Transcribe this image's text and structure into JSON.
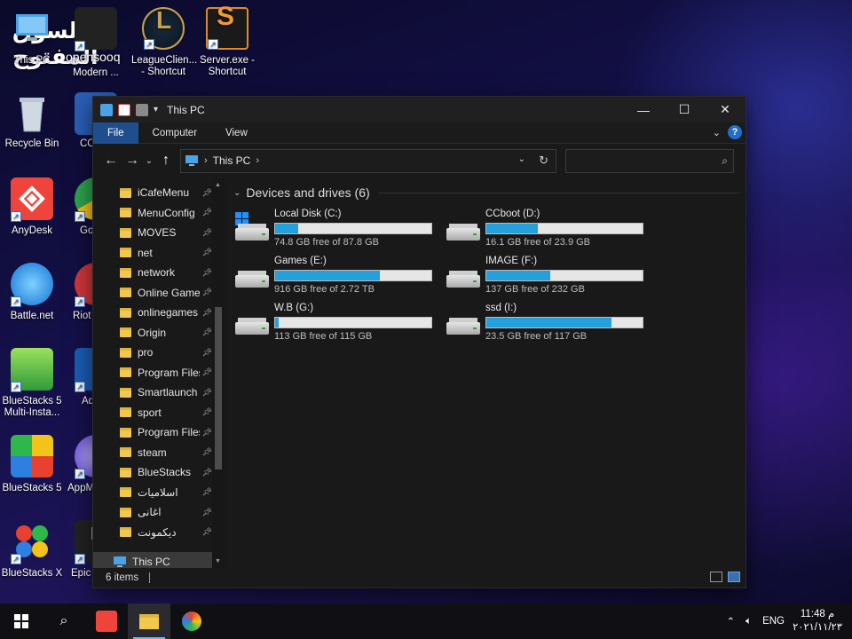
{
  "watermark": {
    "arabic": "السوق المفتوح",
    "latin": "opensooq"
  },
  "desktop": {
    "icons": [
      {
        "label": "This PC"
      },
      {
        "label": "Modern ..."
      },
      {
        "label": "LeagueClien... - Shortcut"
      },
      {
        "label": "Server.exe - Shortcut"
      },
      {
        "label": "Recycle Bin"
      },
      {
        "label": "CC"
      },
      {
        "label": "AnyDesk"
      },
      {
        "label": "Go Ch"
      },
      {
        "label": "Battle.net"
      },
      {
        "label": "Riot"
      },
      {
        "label": "BlueStacks 5 Multi-Insta..."
      },
      {
        "label": "Ad"
      },
      {
        "label": "BlueStacks 5"
      },
      {
        "label": "AppM - Sh"
      },
      {
        "label": "BlueStacks X"
      },
      {
        "label": "Epic Lau"
      }
    ]
  },
  "window": {
    "title": "This PC",
    "ribbon_tabs": [
      "File",
      "Computer",
      "View"
    ],
    "help": "?",
    "address": {
      "crumb": "This PC"
    },
    "search": {
      "placeholder": ""
    },
    "nav_items": [
      {
        "label": "iCafeMenu"
      },
      {
        "label": "MenuConfig"
      },
      {
        "label": "MOVES"
      },
      {
        "label": "net"
      },
      {
        "label": "network"
      },
      {
        "label": "Online Game"
      },
      {
        "label": "onlinegames"
      },
      {
        "label": "Origin"
      },
      {
        "label": "pro"
      },
      {
        "label": "Program Files"
      },
      {
        "label": "Smartlaunch"
      },
      {
        "label": "sport"
      },
      {
        "label": "Program Files"
      },
      {
        "label": "steam"
      },
      {
        "label": "BlueStacks"
      },
      {
        "label": "اسلاميات"
      },
      {
        "label": "اغانى"
      },
      {
        "label": "ديكمونت"
      }
    ],
    "nav_selected": "This PC",
    "group_title": "Devices and drives (6)",
    "drives": [
      {
        "name": "Local Disk (C:)",
        "free": "74.8 GB free of 87.8 GB",
        "used_fraction": 0.15,
        "windows": true
      },
      {
        "name": "CCboot (D:)",
        "free": "16.1 GB free of 23.9 GB",
        "used_fraction": 0.33,
        "windows": false
      },
      {
        "name": "Games (E:)",
        "free": "916 GB free of 2.72 TB",
        "used_fraction": 0.67,
        "windows": false
      },
      {
        "name": "IMAGE (F:)",
        "free": "137 GB free of 232 GB",
        "used_fraction": 0.41,
        "windows": false
      },
      {
        "name": "W.B (G:)",
        "free": "113 GB free of 115 GB",
        "used_fraction": 0.02,
        "windows": false
      },
      {
        "name": "ssd (I:)",
        "free": "23.5 GB free of 117 GB",
        "used_fraction": 0.8,
        "windows": false
      }
    ],
    "status": {
      "count": "6 items"
    }
  },
  "taskbar": {
    "language": "ENG",
    "time": "11:48 م",
    "date": "٢٠٢١/١١/٢٣"
  },
  "colors": {
    "accent": "#26a0da",
    "file_tab": "#1f4e8f"
  }
}
